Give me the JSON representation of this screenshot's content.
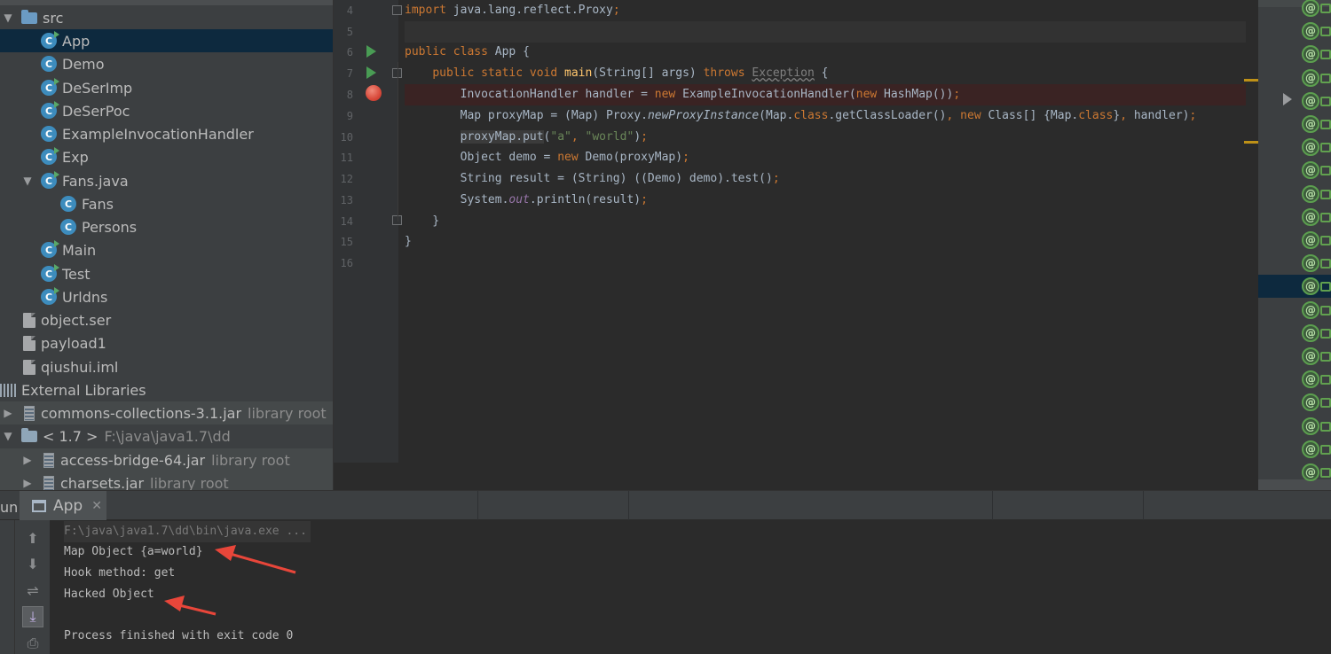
{
  "project_tree": {
    "items": [
      {
        "label": "src",
        "type": "folder",
        "indent": 0,
        "expanded": true
      },
      {
        "label": "App",
        "type": "class-runnable",
        "indent": 1,
        "selected": true
      },
      {
        "label": "Demo",
        "type": "class",
        "indent": 1
      },
      {
        "label": "DeSerImp",
        "type": "class-runnable",
        "indent": 1
      },
      {
        "label": "DeSerPoc",
        "type": "class-runnable",
        "indent": 1
      },
      {
        "label": "ExampleInvocationHandler",
        "type": "class",
        "indent": 1
      },
      {
        "label": "Exp",
        "type": "class-runnable",
        "indent": 1
      },
      {
        "label": "Fans.java",
        "type": "class-runnable",
        "indent": 1,
        "expanded": true
      },
      {
        "label": "Fans",
        "type": "class",
        "indent": 2
      },
      {
        "label": "Persons",
        "type": "class",
        "indent": 2
      },
      {
        "label": "Main",
        "type": "class-runnable",
        "indent": 1
      },
      {
        "label": "Test",
        "type": "class-runnable",
        "indent": 1
      },
      {
        "label": "Urldns",
        "type": "class-runnable",
        "indent": 1
      },
      {
        "label": "object.ser",
        "type": "file",
        "indent": 0
      },
      {
        "label": "payload1",
        "type": "file",
        "indent": 0
      },
      {
        "label": "qiushui.iml",
        "type": "file",
        "indent": 0
      },
      {
        "label": "External Libraries",
        "type": "libraries",
        "indent": -1
      },
      {
        "label": "commons-collections-3.1.jar",
        "suffix": "library root",
        "type": "jar",
        "indent": 0,
        "collapsed": true
      },
      {
        "label": "< 1.7 >",
        "suffix": "F:\\java\\java1.7\\dd",
        "type": "jdk",
        "indent": 0,
        "expanded": true
      },
      {
        "label": "access-bridge-64.jar",
        "suffix": "library root",
        "type": "jar",
        "indent": 1,
        "collapsed": true
      },
      {
        "label": "charsets.jar",
        "suffix": "library root",
        "type": "jar",
        "indent": 1,
        "collapsed": true
      }
    ]
  },
  "editor": {
    "line_numbers": [
      "4",
      "5",
      "6",
      "7",
      "8",
      "9",
      "10",
      "11",
      "12",
      "13",
      "14",
      "15",
      "16"
    ],
    "code_text": {
      "l4_import": "import",
      "l4_rest": " java.lang.reflect.Proxy",
      "semi": ";",
      "l6_public": "public",
      "l6_class": " class",
      "l6_rest": " App {",
      "l7_indent": "    ",
      "l7_mods": "public static void",
      "l7_main": " main",
      "l7_params": "(String[] args) ",
      "l7_throws": "throws",
      "l7_exc": "Exception",
      "l7_brace": " {",
      "l8_a": "        InvocationHandler handler = ",
      "new": "new",
      "l8_b": " ExampleInvocationHandler(",
      "l8_c": " HashMap())",
      "l9_a": "        Map proxyMap = (Map) Proxy.",
      "l9_method": "newProxyInstance",
      "l9_b": "(Map.",
      "class_kw": "class",
      "l9_c": ".getClassLoader()",
      "comma": ", ",
      "l9_d": " Class[] {Map.",
      "l9_e": "}",
      "l9_f": "handler)",
      "l10_a": "        ",
      "l10_put": "proxyMap.put",
      "l10_b": "(",
      "str_a": "\"a\"",
      "str_world": "\"world\"",
      "l10_c": ")",
      "l11_a": "        Object demo = ",
      "l11_b": " Demo(proxyMap)",
      "l12_a": "        String result = (String) ((Demo) demo).test()",
      "l13_a": "        System.",
      "l13_out": "out",
      "l13_b": ".println(result)",
      "l14": "    }",
      "l15": "}"
    }
  },
  "run_panel": {
    "label": "un:",
    "tab_label": "App",
    "close_glyph": "✕",
    "toolbar": [
      {
        "name": "scroll-up-button",
        "glyph": "⬆"
      },
      {
        "name": "scroll-down-button",
        "glyph": "⬇"
      },
      {
        "name": "soft-wrap-button",
        "glyph": "⇌"
      },
      {
        "name": "scroll-to-end-button",
        "glyph": "⤓"
      },
      {
        "name": "print-button",
        "glyph": "⎙"
      }
    ],
    "output": [
      "F:\\java\\java1.7\\dd\\bin\\java.exe ...",
      "Map Object {a=world}",
      "Hook method: get",
      "Hacked Object",
      "",
      "Process finished with exit code 0"
    ]
  },
  "structure_panel": {
    "icon_letter": "@"
  },
  "colors": {
    "keyword": "#cc7832",
    "method": "#ffc66d",
    "string": "#6a8759",
    "field": "#9876aa",
    "annotation_arrow": "#e8463a",
    "selection": "#0d293e"
  }
}
